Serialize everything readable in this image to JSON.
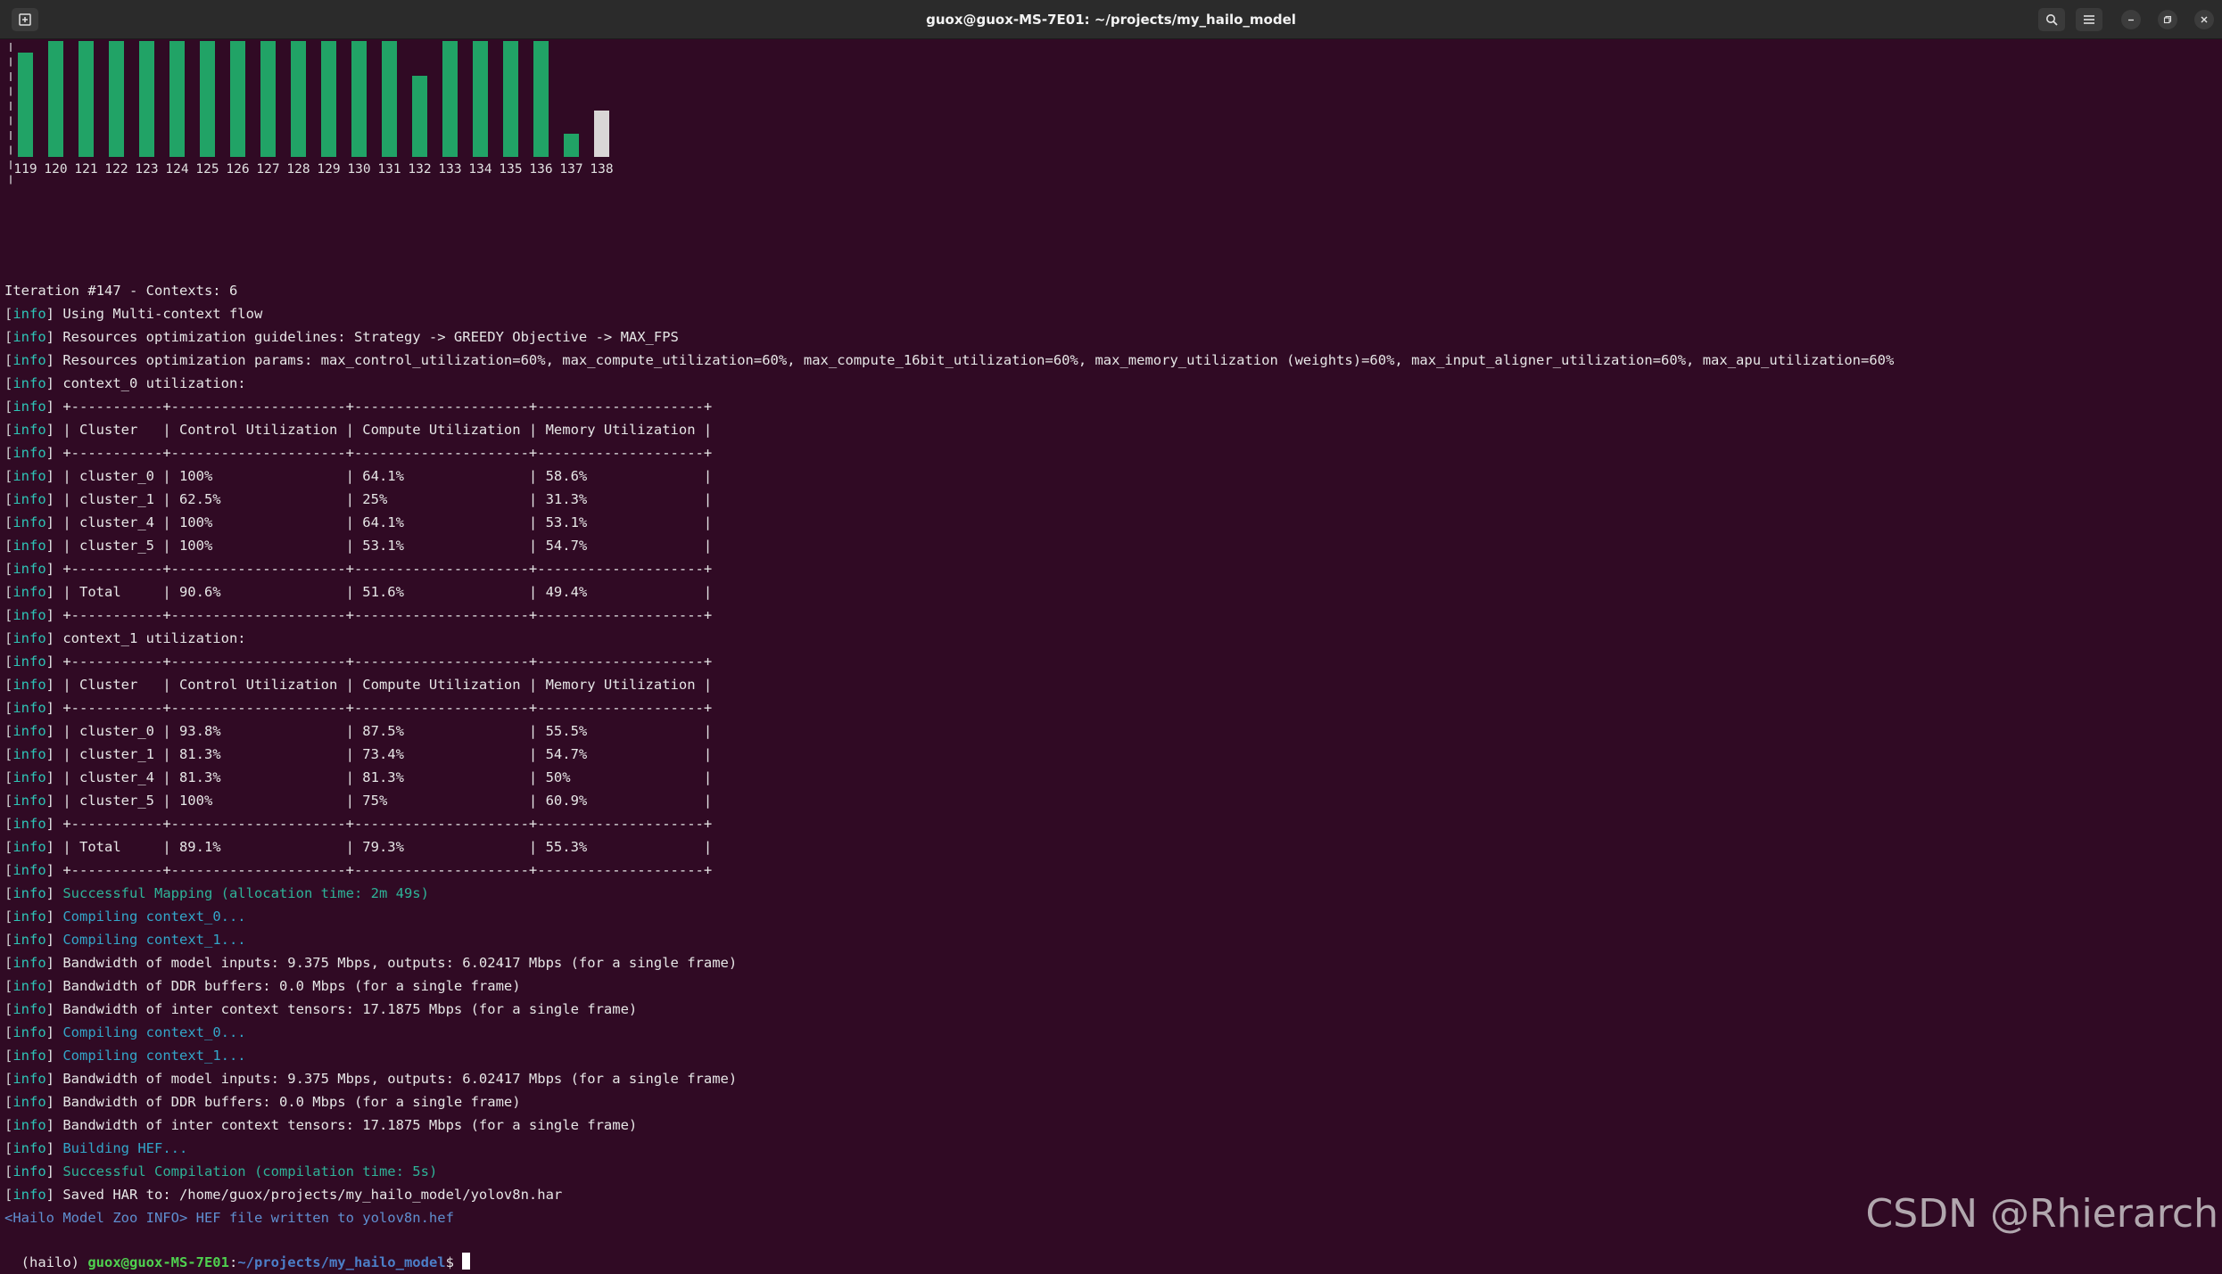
{
  "window": {
    "title": "guox@guox-MS-7E01: ~/projects/my_hailo_model",
    "icons": [
      "new-tab-icon",
      "search-icon",
      "hamburger-menu-icon",
      "minimize-icon",
      "maximize-icon",
      "close-icon"
    ]
  },
  "chart_data": {
    "type": "bar",
    "categories": [
      "119",
      "120",
      "121",
      "122",
      "123",
      "124",
      "125",
      "126",
      "127",
      "128",
      "129",
      "130",
      "131",
      "132",
      "133",
      "134",
      "135",
      "136",
      "137",
      "138"
    ],
    "values": [
      9,
      10,
      10,
      10,
      10,
      10,
      10,
      10,
      10,
      10,
      10,
      10,
      10,
      7,
      10,
      10,
      10,
      10,
      2,
      4
    ],
    "highlighted_category": "138",
    "colors": {
      "bar": "#21a366",
      "highlight": "#d9d6d6"
    }
  },
  "log": [
    {
      "segs": [
        {
          "t": "Iteration #147 - Contexts: 6"
        }
      ]
    },
    {
      "segs": [
        {
          "t": "[",
          "c": "dim"
        },
        {
          "t": "info",
          "c": "tag"
        },
        {
          "t": "] Using Multi-context flow"
        }
      ]
    },
    {
      "segs": [
        {
          "t": "[",
          "c": "dim"
        },
        {
          "t": "info",
          "c": "tag"
        },
        {
          "t": "] Resources optimization guidelines: Strategy -> GREEDY Objective -> MAX_FPS"
        }
      ]
    },
    {
      "segs": [
        {
          "t": "[",
          "c": "dim"
        },
        {
          "t": "info",
          "c": "tag"
        },
        {
          "t": "] Resources optimization params: max_control_utilization=60%, max_compute_utilization=60%, max_compute_16bit_utilization=60%, max_memory_utilization (weights)=60%, max_input_aligner_utilization=60%, max_apu_utilization=60%"
        }
      ]
    },
    {
      "segs": [
        {
          "t": "[",
          "c": "dim"
        },
        {
          "t": "info",
          "c": "tag"
        },
        {
          "t": "] context_0 utilization:"
        }
      ]
    },
    {
      "segs": [
        {
          "t": "[",
          "c": "dim"
        },
        {
          "t": "info",
          "c": "tag"
        },
        {
          "t": "] +-----------+---------------------+---------------------+--------------------+"
        }
      ]
    },
    {
      "segs": [
        {
          "t": "[",
          "c": "dim"
        },
        {
          "t": "info",
          "c": "tag"
        },
        {
          "t": "] | Cluster   | Control Utilization | Compute Utilization | Memory Utilization |"
        }
      ]
    },
    {
      "segs": [
        {
          "t": "[",
          "c": "dim"
        },
        {
          "t": "info",
          "c": "tag"
        },
        {
          "t": "] +-----------+---------------------+---------------------+--------------------+"
        }
      ]
    },
    {
      "segs": [
        {
          "t": "[",
          "c": "dim"
        },
        {
          "t": "info",
          "c": "tag"
        },
        {
          "t": "] | cluster_0 | 100%                | 64.1%               | 58.6%              |"
        }
      ]
    },
    {
      "segs": [
        {
          "t": "[",
          "c": "dim"
        },
        {
          "t": "info",
          "c": "tag"
        },
        {
          "t": "] | cluster_1 | 62.5%               | 25%                 | 31.3%              |"
        }
      ]
    },
    {
      "segs": [
        {
          "t": "[",
          "c": "dim"
        },
        {
          "t": "info",
          "c": "tag"
        },
        {
          "t": "] | cluster_4 | 100%                | 64.1%               | 53.1%              |"
        }
      ]
    },
    {
      "segs": [
        {
          "t": "[",
          "c": "dim"
        },
        {
          "t": "info",
          "c": "tag"
        },
        {
          "t": "] | cluster_5 | 100%                | 53.1%               | 54.7%              |"
        }
      ]
    },
    {
      "segs": [
        {
          "t": "[",
          "c": "dim"
        },
        {
          "t": "info",
          "c": "tag"
        },
        {
          "t": "] +-----------+---------------------+---------------------+--------------------+"
        }
      ]
    },
    {
      "segs": [
        {
          "t": "[",
          "c": "dim"
        },
        {
          "t": "info",
          "c": "tag"
        },
        {
          "t": "] | Total     | 90.6%               | 51.6%               | 49.4%              |"
        }
      ]
    },
    {
      "segs": [
        {
          "t": "[",
          "c": "dim"
        },
        {
          "t": "info",
          "c": "tag"
        },
        {
          "t": "] +-----------+---------------------+---------------------+--------------------+"
        }
      ]
    },
    {
      "segs": [
        {
          "t": "[",
          "c": "dim"
        },
        {
          "t": "info",
          "c": "tag"
        },
        {
          "t": "] context_1 utilization:"
        }
      ]
    },
    {
      "segs": [
        {
          "t": "[",
          "c": "dim"
        },
        {
          "t": "info",
          "c": "tag"
        },
        {
          "t": "] +-----------+---------------------+---------------------+--------------------+"
        }
      ]
    },
    {
      "segs": [
        {
          "t": "[",
          "c": "dim"
        },
        {
          "t": "info",
          "c": "tag"
        },
        {
          "t": "] | Cluster   | Control Utilization | Compute Utilization | Memory Utilization |"
        }
      ]
    },
    {
      "segs": [
        {
          "t": "[",
          "c": "dim"
        },
        {
          "t": "info",
          "c": "tag"
        },
        {
          "t": "] +-----------+---------------------+---------------------+--------------------+"
        }
      ]
    },
    {
      "segs": [
        {
          "t": "[",
          "c": "dim"
        },
        {
          "t": "info",
          "c": "tag"
        },
        {
          "t": "] | cluster_0 | 93.8%               | 87.5%               | 55.5%              |"
        }
      ]
    },
    {
      "segs": [
        {
          "t": "[",
          "c": "dim"
        },
        {
          "t": "info",
          "c": "tag"
        },
        {
          "t": "] | cluster_1 | 81.3%               | 73.4%               | 54.7%              |"
        }
      ]
    },
    {
      "segs": [
        {
          "t": "[",
          "c": "dim"
        },
        {
          "t": "info",
          "c": "tag"
        },
        {
          "t": "] | cluster_4 | 81.3%               | 81.3%               | 50%                |"
        }
      ]
    },
    {
      "segs": [
        {
          "t": "[",
          "c": "dim"
        },
        {
          "t": "info",
          "c": "tag"
        },
        {
          "t": "] | cluster_5 | 100%                | 75%                 | 60.9%              |"
        }
      ]
    },
    {
      "segs": [
        {
          "t": "[",
          "c": "dim"
        },
        {
          "t": "info",
          "c": "tag"
        },
        {
          "t": "] +-----------+---------------------+---------------------+--------------------+"
        }
      ]
    },
    {
      "segs": [
        {
          "t": "[",
          "c": "dim"
        },
        {
          "t": "info",
          "c": "tag"
        },
        {
          "t": "] | Total     | 89.1%               | 79.3%               | 55.3%              |"
        }
      ]
    },
    {
      "segs": [
        {
          "t": "[",
          "c": "dim"
        },
        {
          "t": "info",
          "c": "tag"
        },
        {
          "t": "] +-----------+---------------------+---------------------+--------------------+"
        }
      ]
    },
    {
      "segs": [
        {
          "t": "[",
          "c": "dim"
        },
        {
          "t": "info",
          "c": "tag"
        },
        {
          "t": "] "
        },
        {
          "t": "Successful Mapping (allocation time: 2m 49s)",
          "c": "hl-green"
        }
      ]
    },
    {
      "segs": [
        {
          "t": "[",
          "c": "dim"
        },
        {
          "t": "info",
          "c": "tag"
        },
        {
          "t": "] "
        },
        {
          "t": "Compiling context_0...",
          "c": "hl-cyan"
        }
      ]
    },
    {
      "segs": [
        {
          "t": "[",
          "c": "dim"
        },
        {
          "t": "info",
          "c": "tag"
        },
        {
          "t": "] "
        },
        {
          "t": "Compiling context_1...",
          "c": "hl-cyan"
        }
      ]
    },
    {
      "segs": [
        {
          "t": "[",
          "c": "dim"
        },
        {
          "t": "info",
          "c": "tag"
        },
        {
          "t": "] Bandwidth of model inputs: 9.375 Mbps, outputs: 6.02417 Mbps (for a single frame)"
        }
      ]
    },
    {
      "segs": [
        {
          "t": "[",
          "c": "dim"
        },
        {
          "t": "info",
          "c": "tag"
        },
        {
          "t": "] Bandwidth of DDR buffers: 0.0 Mbps (for a single frame)"
        }
      ]
    },
    {
      "segs": [
        {
          "t": "[",
          "c": "dim"
        },
        {
          "t": "info",
          "c": "tag"
        },
        {
          "t": "] Bandwidth of inter context tensors: 17.1875 Mbps (for a single frame)"
        }
      ]
    },
    {
      "segs": [
        {
          "t": "[",
          "c": "dim"
        },
        {
          "t": "info",
          "c": "tag"
        },
        {
          "t": "] "
        },
        {
          "t": "Compiling context_0...",
          "c": "hl-cyan"
        }
      ]
    },
    {
      "segs": [
        {
          "t": "[",
          "c": "dim"
        },
        {
          "t": "info",
          "c": "tag"
        },
        {
          "t": "] "
        },
        {
          "t": "Compiling context_1...",
          "c": "hl-cyan"
        }
      ]
    },
    {
      "segs": [
        {
          "t": "[",
          "c": "dim"
        },
        {
          "t": "info",
          "c": "tag"
        },
        {
          "t": "] Bandwidth of model inputs: 9.375 Mbps, outputs: 6.02417 Mbps (for a single frame)"
        }
      ]
    },
    {
      "segs": [
        {
          "t": "[",
          "c": "dim"
        },
        {
          "t": "info",
          "c": "tag"
        },
        {
          "t": "] Bandwidth of DDR buffers: 0.0 Mbps (for a single frame)"
        }
      ]
    },
    {
      "segs": [
        {
          "t": "[",
          "c": "dim"
        },
        {
          "t": "info",
          "c": "tag"
        },
        {
          "t": "] Bandwidth of inter context tensors: 17.1875 Mbps (for a single frame)"
        }
      ]
    },
    {
      "segs": [
        {
          "t": "[",
          "c": "dim"
        },
        {
          "t": "info",
          "c": "tag"
        },
        {
          "t": "] "
        },
        {
          "t": "Building HEF...",
          "c": "hl-cyan"
        }
      ]
    },
    {
      "segs": [
        {
          "t": "[",
          "c": "dim"
        },
        {
          "t": "info",
          "c": "tag"
        },
        {
          "t": "] "
        },
        {
          "t": "Successful Compilation (compilation time: 5s)",
          "c": "hl-green"
        }
      ]
    },
    {
      "segs": [
        {
          "t": "[",
          "c": "dim"
        },
        {
          "t": "info",
          "c": "tag"
        },
        {
          "t": "] Saved HAR to: /home/guox/projects/my_hailo_model/yolov8n.har"
        }
      ]
    },
    {
      "segs": [
        {
          "t": "<Hailo Model Zoo INFO> HEF file written to yolov8n.hef",
          "c": "zoo"
        }
      ]
    }
  ],
  "prompt": {
    "env": "(hailo) ",
    "user_host": "guox@guox-MS-7E01",
    "sep": ":",
    "path": "~/projects/my_hailo_model",
    "symbol": "$ "
  },
  "watermark": "CSDN @Rhierarch"
}
